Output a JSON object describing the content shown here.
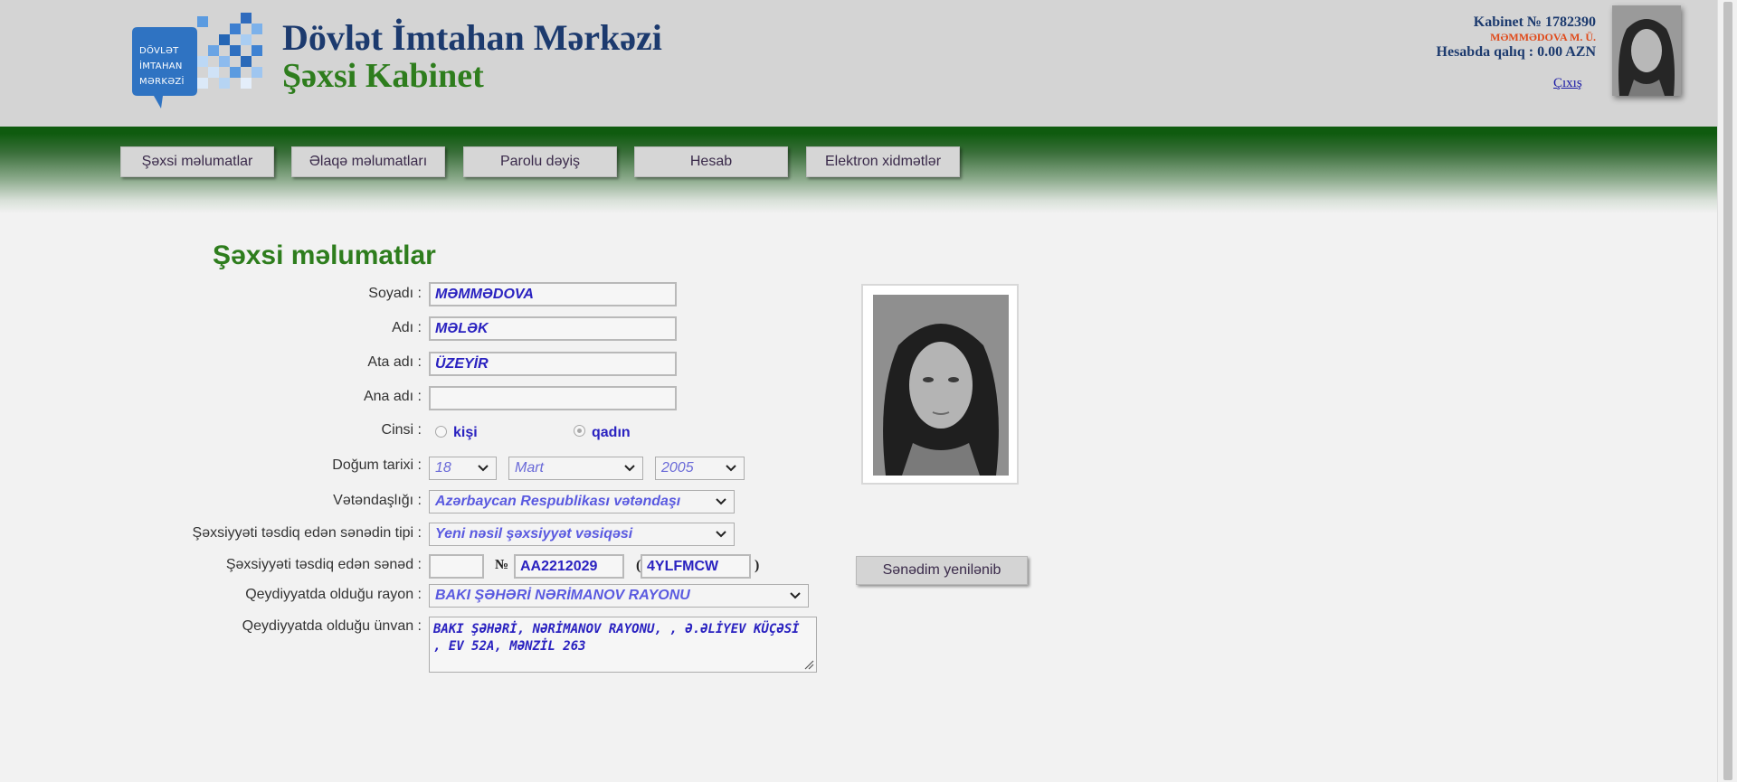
{
  "header": {
    "logo_lines": [
      "DÖVLƏT",
      "İMTAHAN",
      "MƏRKƏZİ"
    ],
    "title": "Dövlət İmtahan Mərkəzi",
    "subtitle": "Şəxsi Kabinet",
    "cabinet": "Kabinet № 1782390",
    "user_name": "MƏMMƏDOVA M. Ü.",
    "balance": "Hesabda qalıq : 0.00 AZN",
    "logout": "Çıxış"
  },
  "nav": [
    "Şəxsi məlumatlar",
    "Əlaqə məlumatları",
    "Parolu dəyiş",
    "Hesab",
    "Elektron xidmətlər"
  ],
  "page_title": "Şəxsi məlumatlar",
  "form": {
    "surname_label": "Soyadı",
    "surname": "MƏMMƏDOVA",
    "name_label": "Adı",
    "name": "MƏLƏK",
    "patronymic_label": "Ata adı",
    "patronymic": "ÜZEYİR",
    "mother_label": "Ana adı",
    "mother": "",
    "gender_label": "Cinsi",
    "gender_male": "kişi",
    "gender_female": "qadın",
    "birth_label": "Doğum tarixi",
    "birth_day": "18",
    "birth_month": "Mart",
    "birth_year": "2005",
    "citizenship_label": "Vətəndaşlığı",
    "citizenship": "Azərbaycan Respublikası vətəndaşı",
    "doc_type_label": "Şəxsiyyəti təsdiq edən sənədin tipi",
    "doc_type": "Yeni nəsil şəxsiyyət vəsiqəsi",
    "doc_label": "Şəxsiyyəti təsdiq edən sənəd",
    "doc_series": "",
    "doc_no_sign": "№",
    "doc_number": "AA2212029",
    "doc_fin": "4YLFMCW",
    "paren_open": "(",
    "paren_close": ")",
    "district_label": "Qeydiyyatda olduğu rayon",
    "district": "BAKI ŞƏHƏRİ NƏRİMANOV RAYONU",
    "address_label": "Qeydiyyatda olduğu ünvan",
    "address": "BAKI ŞƏHƏRİ, NƏRİMANOV RAYONU, , Ə.ƏLİYEV KÜÇƏSİ , EV 52A, MƏNZİL 263"
  },
  "renew_button": "Sənədim yenilənib",
  "colors": {
    "brand_blue": "#1c3a6e",
    "brand_green": "#2e7d1d",
    "value_blue": "#2a22c0",
    "nav_green": "#0f5b0f"
  }
}
